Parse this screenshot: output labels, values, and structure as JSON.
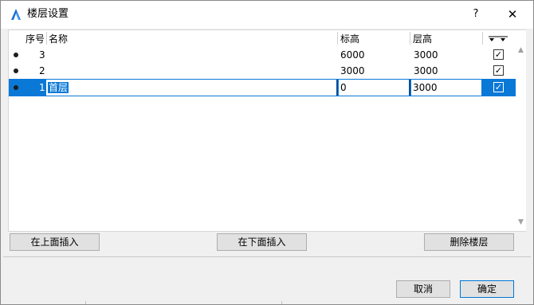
{
  "window": {
    "title": "楼层设置",
    "help_label": "?",
    "close_label": "✕"
  },
  "table": {
    "columns": {
      "index": "序号",
      "name": "名称",
      "elevation": "标高",
      "height": "层高"
    },
    "rows": [
      {
        "index": "3",
        "name": "",
        "elevation": "6000",
        "height": "3000",
        "checked": true
      },
      {
        "index": "2",
        "name": "",
        "elevation": "3000",
        "height": "3000",
        "checked": true
      },
      {
        "index": "1",
        "name": "首层",
        "elevation": "0",
        "height": "3000",
        "checked": true
      }
    ]
  },
  "buttons": {
    "insert_above": "在上面插入",
    "insert_below": "在下面插入",
    "delete_floor": "删除楼层",
    "cancel": "取消",
    "ok": "确定"
  },
  "colors": {
    "selection": "#0a78d7",
    "window_bg": "#f0f0f0",
    "app_icon": "#1a6fd8"
  }
}
